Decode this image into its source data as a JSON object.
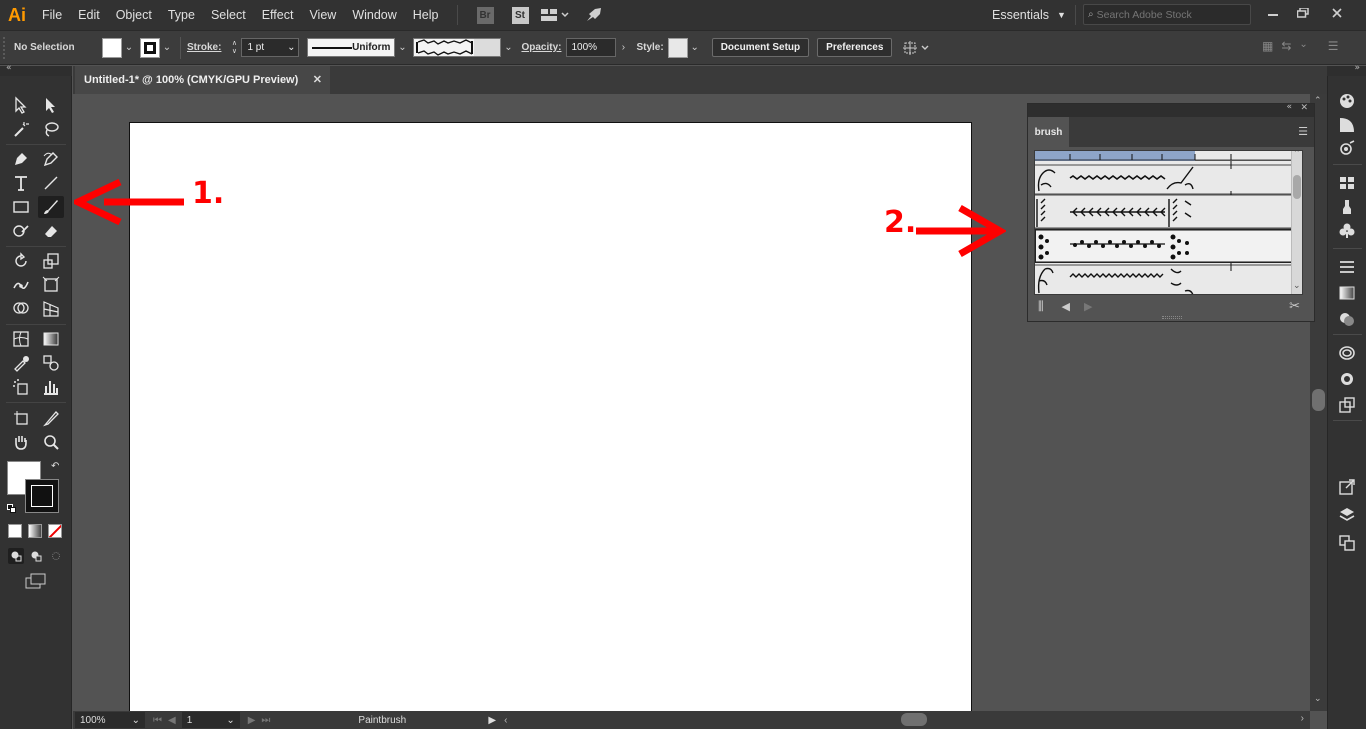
{
  "app": {
    "logo": "Ai",
    "accent_color": "#ff9a00"
  },
  "menu": {
    "items": [
      "File",
      "Edit",
      "Object",
      "Type",
      "Select",
      "Effect",
      "View",
      "Window",
      "Help"
    ],
    "bridge_label": "Br",
    "stock_label": "St",
    "workspace": "Essentials",
    "search_placeholder": "Search Adobe Stock"
  },
  "controlbar": {
    "selection_label": "No Selection",
    "stroke_label": "Stroke:",
    "stroke_weight": "1 pt",
    "profile_label": "Uniform",
    "opacity_label": "Opacity:",
    "opacity_value": "100%",
    "style_label": "Style:",
    "document_setup": "Document Setup",
    "preferences": "Preferences"
  },
  "document": {
    "tab_title": "Untitled-1* @ 100% (CMYK/GPU Preview)",
    "close_glyph": "✕"
  },
  "statusbar": {
    "zoom": "100%",
    "artboard_number": "1",
    "current_tool": "Paintbrush"
  },
  "brush_panel": {
    "tab_label": "brush",
    "selected_row_index": 2
  },
  "annotations": {
    "label_1": "1.",
    "label_2": "2.",
    "color": "#ff0000"
  }
}
